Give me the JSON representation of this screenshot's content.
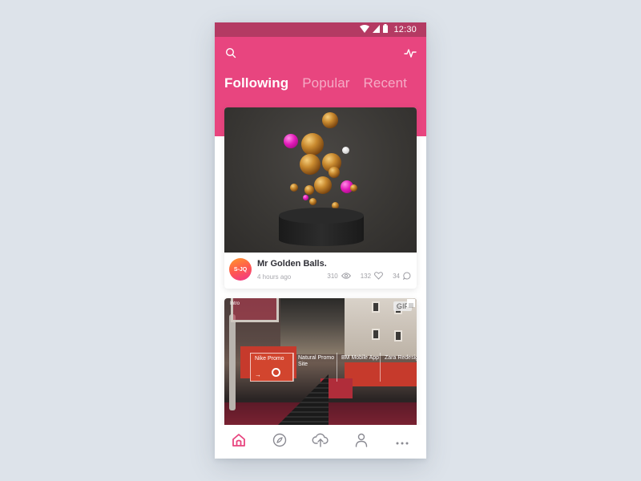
{
  "status_bar": {
    "time": "12:30",
    "icons": [
      "wifi-icon",
      "cellular-signal-icon",
      "battery-icon"
    ]
  },
  "top_bar": {
    "left_icon": "search-icon",
    "right_icon": "activity-icon"
  },
  "tabs": [
    {
      "label": "Following",
      "active": true
    },
    {
      "label": "Popular",
      "active": false
    },
    {
      "label": "Recent",
      "active": false
    }
  ],
  "posts": [
    {
      "title": "Mr Golden Balls.",
      "time": "4 hours ago",
      "avatar_initials": "S-JQ",
      "views": "310",
      "likes": "132",
      "comments": "34"
    },
    {
      "badge": "GIF",
      "intro_label": "Intro",
      "projects": [
        {
          "label": "Nike Promo",
          "active": true
        },
        {
          "label": "Natural Promo Site",
          "active": false
        },
        {
          "label": "BM Mobile App",
          "active": false
        },
        {
          "label": "Zara Redesign",
          "active": false
        }
      ],
      "project_arrow": "→"
    }
  ],
  "bottom_nav": [
    {
      "icon": "home-icon",
      "active": true
    },
    {
      "icon": "compass-icon",
      "active": false
    },
    {
      "icon": "upload-cloud-icon",
      "active": false
    },
    {
      "icon": "profile-icon",
      "active": false
    },
    {
      "icon": "more-icon",
      "active": false
    }
  ],
  "colors": {
    "accent": "#e8457f",
    "status_bar": "#b43a63",
    "nav_inactive": "#8a8a92",
    "background": "#dde3ea"
  }
}
